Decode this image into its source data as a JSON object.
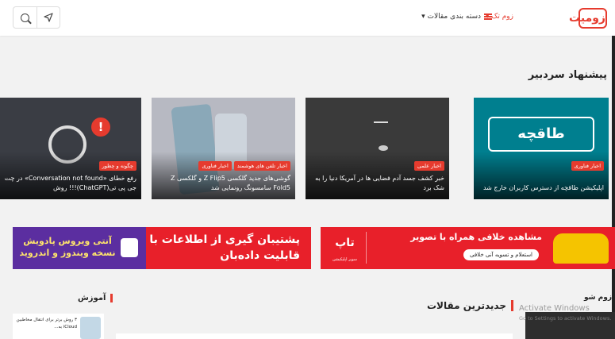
{
  "header": {
    "logo_text": "زومیت",
    "nav_zoomtech": "زوم تک ▾",
    "nav_categories": "دسته بندی مقالات ▾"
  },
  "editor_pick": {
    "title": "پیشنهاد سردبیر",
    "cards": [
      {
        "category": "اخبار فناوری",
        "title": "اپلیکیشن طاقچه از دسترس کاربران خارج شد",
        "image_text": "طاقچه"
      },
      {
        "category": "اخبار علمی",
        "title": "خبر کشف جسد آدم فضایی ها در آمریکا دنیا را به شک برد"
      },
      {
        "categories": [
          "اخبار تلفن های هوشمند",
          "اخبار فناوری"
        ],
        "title": "گوشی‌های جدید گلکسی Z Flip5 و گلکسی Z Fold5 سامسونگ رونمایی شد"
      },
      {
        "category": "چگونه و چطور",
        "title": "رفع خطای «Conversation not found» در چت جی پی تی(ChatGPT)!!! روش"
      }
    ]
  },
  "ads": {
    "left": {
      "violet_text": "آنتی ویروس پادویش نسخه ویندوز و اندروید",
      "main_text": "پشتیبان گیری از اطلاعات با قابلیت داده‌بان"
    },
    "right": {
      "headline": "مشاهده خلافی همراه با تصویر",
      "pill": "استعلام و تسویه آنی خلافی",
      "brand": "تاپ",
      "brand_sub": "سوپر اپلیکیشن"
    }
  },
  "sections": {
    "zoom_show": "زوم شو",
    "latest": "جدیدترین مقالات",
    "learning": "آموزش"
  },
  "learning_item": {
    "title": "۳ روش برتر برای انتقال مخاطبین iCloud به..."
  },
  "watermark": {
    "line1": "Activate Windows",
    "line2": "Go to Settings to activate Windows."
  },
  "colors": {
    "accent": "#e63b2e",
    "teal": "#007f8f"
  },
  "icons": [
    "search-icon",
    "send-icon",
    "menu-icon",
    "warning-icon"
  ]
}
